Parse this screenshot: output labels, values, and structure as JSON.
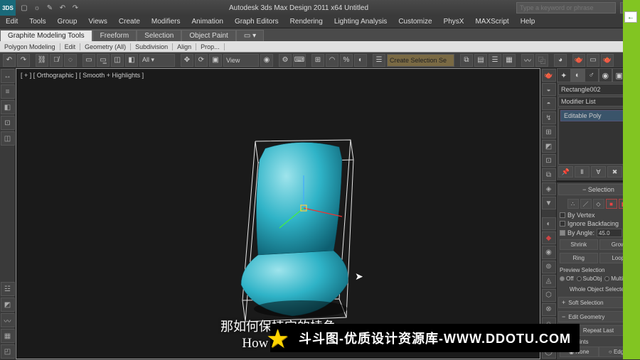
{
  "titlebar": {
    "app_name": "3DS",
    "title": "Autodesk 3ds Max Design 2011 x64      Untitled",
    "search_placeholder": "Type a keyword or phrase"
  },
  "menu": [
    "Edit",
    "Tools",
    "Group",
    "Views",
    "Create",
    "Modifiers",
    "Animation",
    "Graph Editors",
    "Rendering",
    "Lighting Analysis",
    "Customize",
    "PhysX",
    "MAXScript",
    "Help"
  ],
  "ribbon": {
    "tabs": [
      "Graphite Modeling Tools",
      "Freeform",
      "Selection",
      "Object Paint"
    ],
    "sub": [
      "Polygon Modeling",
      "Edit",
      "Geometry (All)",
      "Subdivision",
      "Align",
      "Prop..."
    ]
  },
  "toolbar": {
    "view_label": "View",
    "selset_label": "Create Selection Se"
  },
  "viewport": {
    "label": "[ + ] [ Orthographic ] [ Smooth + Highlights ]"
  },
  "cmdpanel": {
    "object_name": "Rectangle002",
    "modifier_list_label": "Modifier List",
    "stack_item": "Editable Poly",
    "rollouts": {
      "selection": "Selection",
      "by_vertex": "By Vertex",
      "ignore_backfacing": "Ignore Backfacing",
      "by_angle": "By Angle:",
      "angle_val": "45.0",
      "shrink": "Shrink",
      "grow": "Grow",
      "ring": "Ring",
      "loop": "Loop",
      "preview": "Preview Selection",
      "off": "Off",
      "subobj": "SubObj",
      "multi": "Multi",
      "whole": "Whole Object Selected",
      "soft": "Soft Selection",
      "editgeo": "Edit Geometry",
      "repeat": "Repeat Last",
      "constraints": "Constraints",
      "none": "None",
      "edge": "Edge"
    }
  },
  "caption": {
    "cn": "那如何保持它的棱角",
    "en": "How that kee"
  },
  "banner": {
    "text": "斗斗图-优质设计资源库-WWW.DDOTU.COM"
  }
}
